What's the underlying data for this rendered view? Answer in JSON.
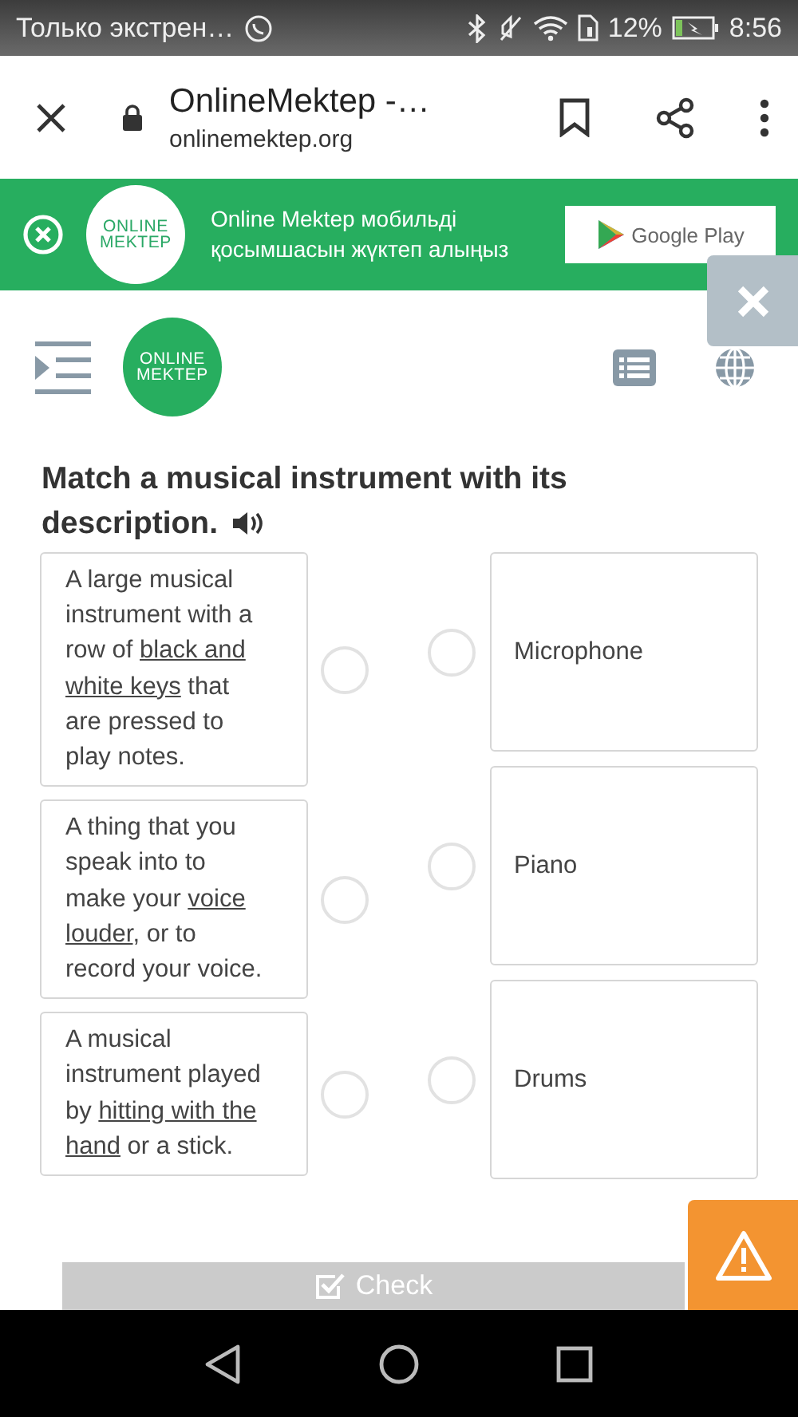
{
  "status_bar": {
    "notification": "Только экстрен…",
    "battery": "12%",
    "time": "8:56"
  },
  "browser": {
    "title": "OnlineMektep -…",
    "url": "onlinemektep.org"
  },
  "app_banner": {
    "logo_lines": [
      "ONLINE",
      "MEKTEP"
    ],
    "text": "Online Mektep мобильді қосымшасын жүктеп алыңыз",
    "store_button": "Google Play"
  },
  "header": {
    "logo_lines": [
      "ONLINE",
      "MEKTEP"
    ]
  },
  "question": {
    "title": "Match a musical instrument with its description."
  },
  "descriptions": [
    {
      "parts": [
        {
          "text": "A large musical instrument with a row of ",
          "underlined": false
        },
        {
          "text": "black and white keys",
          "underlined": true
        },
        {
          "text": " that are pressed to play notes.",
          "underlined": false
        }
      ],
      "selected": false
    },
    {
      "parts": [
        {
          "text": "A thing that you speak into to make your ",
          "underlined": false
        },
        {
          "text": "voice louder",
          "underlined": true
        },
        {
          "text": ", or to record your voice.",
          "underlined": false
        }
      ],
      "selected": false
    },
    {
      "parts": [
        {
          "text": "A musical instrument played by ",
          "underlined": false
        },
        {
          "text": "hitting with the hand",
          "underlined": true
        },
        {
          "text": " or a stick.",
          "underlined": false
        }
      ],
      "selected": false
    }
  ],
  "answers": [
    {
      "label": "Microphone",
      "selected": false
    },
    {
      "label": "Piano",
      "selected": false
    },
    {
      "label": "Drums",
      "selected": false
    }
  ],
  "check_button": {
    "label": "Check",
    "disabled": true
  }
}
